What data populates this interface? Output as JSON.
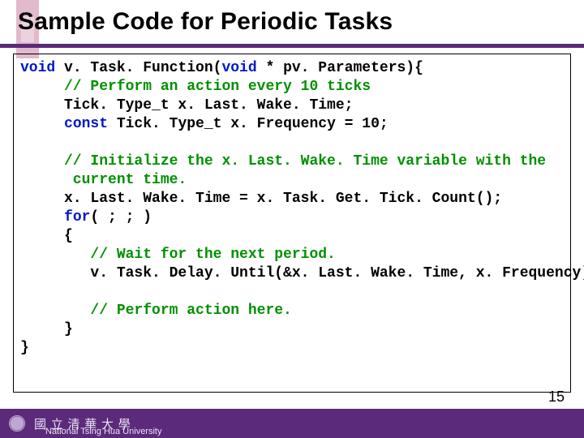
{
  "title": "Sample Code for Periodic Tasks",
  "code": {
    "l1a": "void",
    "l1b": " v. Task. Function(",
    "l1c": "void",
    "l1d": " * pv. Parameters){",
    "l2": "     // Perform an action every 10 ticks",
    "l3": "     Tick. Type_t x. Last. Wake. Time;",
    "l4a": "     ",
    "l4b": "const",
    "l4c": " Tick. Type_t x. Frequency = 10;",
    "blank1": " ",
    "l5a": "     // Initialize the x. Last. Wake. Time variable with the",
    "l5b": "      current time.",
    "l6": "     x. Last. Wake. Time = x. Task. Get. Tick. Count();",
    "l7a": "     ",
    "l7b": "for",
    "l7c": "( ; ; )",
    "l8": "     {",
    "l9": "        // Wait for the next period.",
    "l10": "        v. Task. Delay. Until(&x. Last. Wake. Time, x. Frequency);",
    "blank2": " ",
    "l11": "        // Perform action here.",
    "l12": "     }",
    "l13": "}"
  },
  "footer": {
    "cn": "國 立 清 華 大 學",
    "en": "National Tsing Hua University"
  },
  "page": "15"
}
